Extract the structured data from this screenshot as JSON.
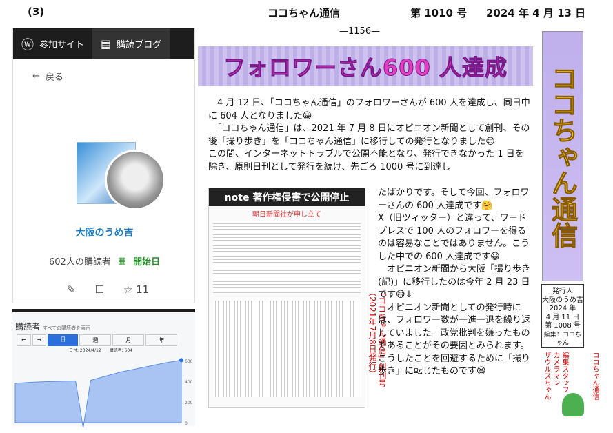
{
  "header": {
    "num": "(3)",
    "title": "ココちゃん通信",
    "issue": "第 1010 号",
    "date": "2024 年 4 月 13 日",
    "page": "—1156—"
  },
  "app": {
    "nav": [
      {
        "label": "参加サイト",
        "icon": "wordpress-icon"
      },
      {
        "label": "購読ブログ",
        "icon": "reader-icon"
      }
    ],
    "back": "戻る",
    "user": "大阪のうめ吉",
    "readers": "602人の購読者",
    "start": "開始日",
    "likes": "11"
  },
  "chart_panel": {
    "title": "購読者",
    "subtitle": "すべての購読者を表示",
    "periods": [
      "日",
      "週",
      "月",
      "年"
    ],
    "date_label": "日付: 2024/4/12",
    "series_label": "購読者: 604"
  },
  "chart_data": {
    "type": "area",
    "title": "購読者",
    "ylim": [
      0,
      600
    ],
    "yticks": [
      "600",
      "400",
      "200",
      "0"
    ],
    "series": [
      {
        "name": "購読者",
        "values": [
          380,
          385,
          390,
          393,
          396,
          398,
          400,
          402,
          404,
          -50,
          410,
          430,
          450,
          470,
          490,
          505,
          520,
          535,
          550,
          565,
          580,
          592,
          604
        ]
      }
    ]
  },
  "banner": {
    "title": "フォロワーさん600 人達成"
  },
  "article": {
    "p1": "　4 月 12 日、「ココちゃん通信」のフォロワーさんが 600 人を達成し、同日中に 604 人となりました😀\n　「ココちゃん通信」は、2021 年 7 月 8 日にオピニオン新聞として創刊、その後「撮り歩き」を「ココちゃん通信」に移行しての発行となりました😊\nこの間、インターネットトラブルで公開不能となり、発行できなかった 1 日を除き、原則日刊として発行を続け、先ごろ 1000 号に到達し",
    "p2": "たばかりです。そして今回、フォロワーさんの 600 人達成です🤗\nX（旧ツィッター）と違って、ワードプレスで 100 人のフォロワーを得るのは容易なことではありません。こうした中での 600 人達成です😀\n　オピニオン新聞から大阪「撮り歩き(記)」に移行したのは今年 2 月 23 日です😅↓\n　オピニオン新聞としての発行時には、フォロワー数が一進一退を繰り返していました。政党批判を嫌ったものであることがその要因とみられます。こうしたことを回避するために「撮り歩き」に転じたものです😆"
  },
  "note_clip": {
    "title": "note 著作権侵害で公開停止",
    "sub": "朝日新聞社が申し立て",
    "vertical": "「ココちゃん通信」創刊号（2021年7月8日発行）"
  },
  "masthead": {
    "text": "ココちゃん通信"
  },
  "info": {
    "lines": [
      "発行人",
      "大阪のうめ吉",
      "2024 年",
      "4 月 11 日",
      "第 1008 号",
      "編集：ココちゃん"
    ]
  },
  "staff": {
    "a": "ココちゃん通信",
    "b": "編集スタッフ",
    "c": "カメラマン",
    "d": "ザウルスちゃん"
  }
}
